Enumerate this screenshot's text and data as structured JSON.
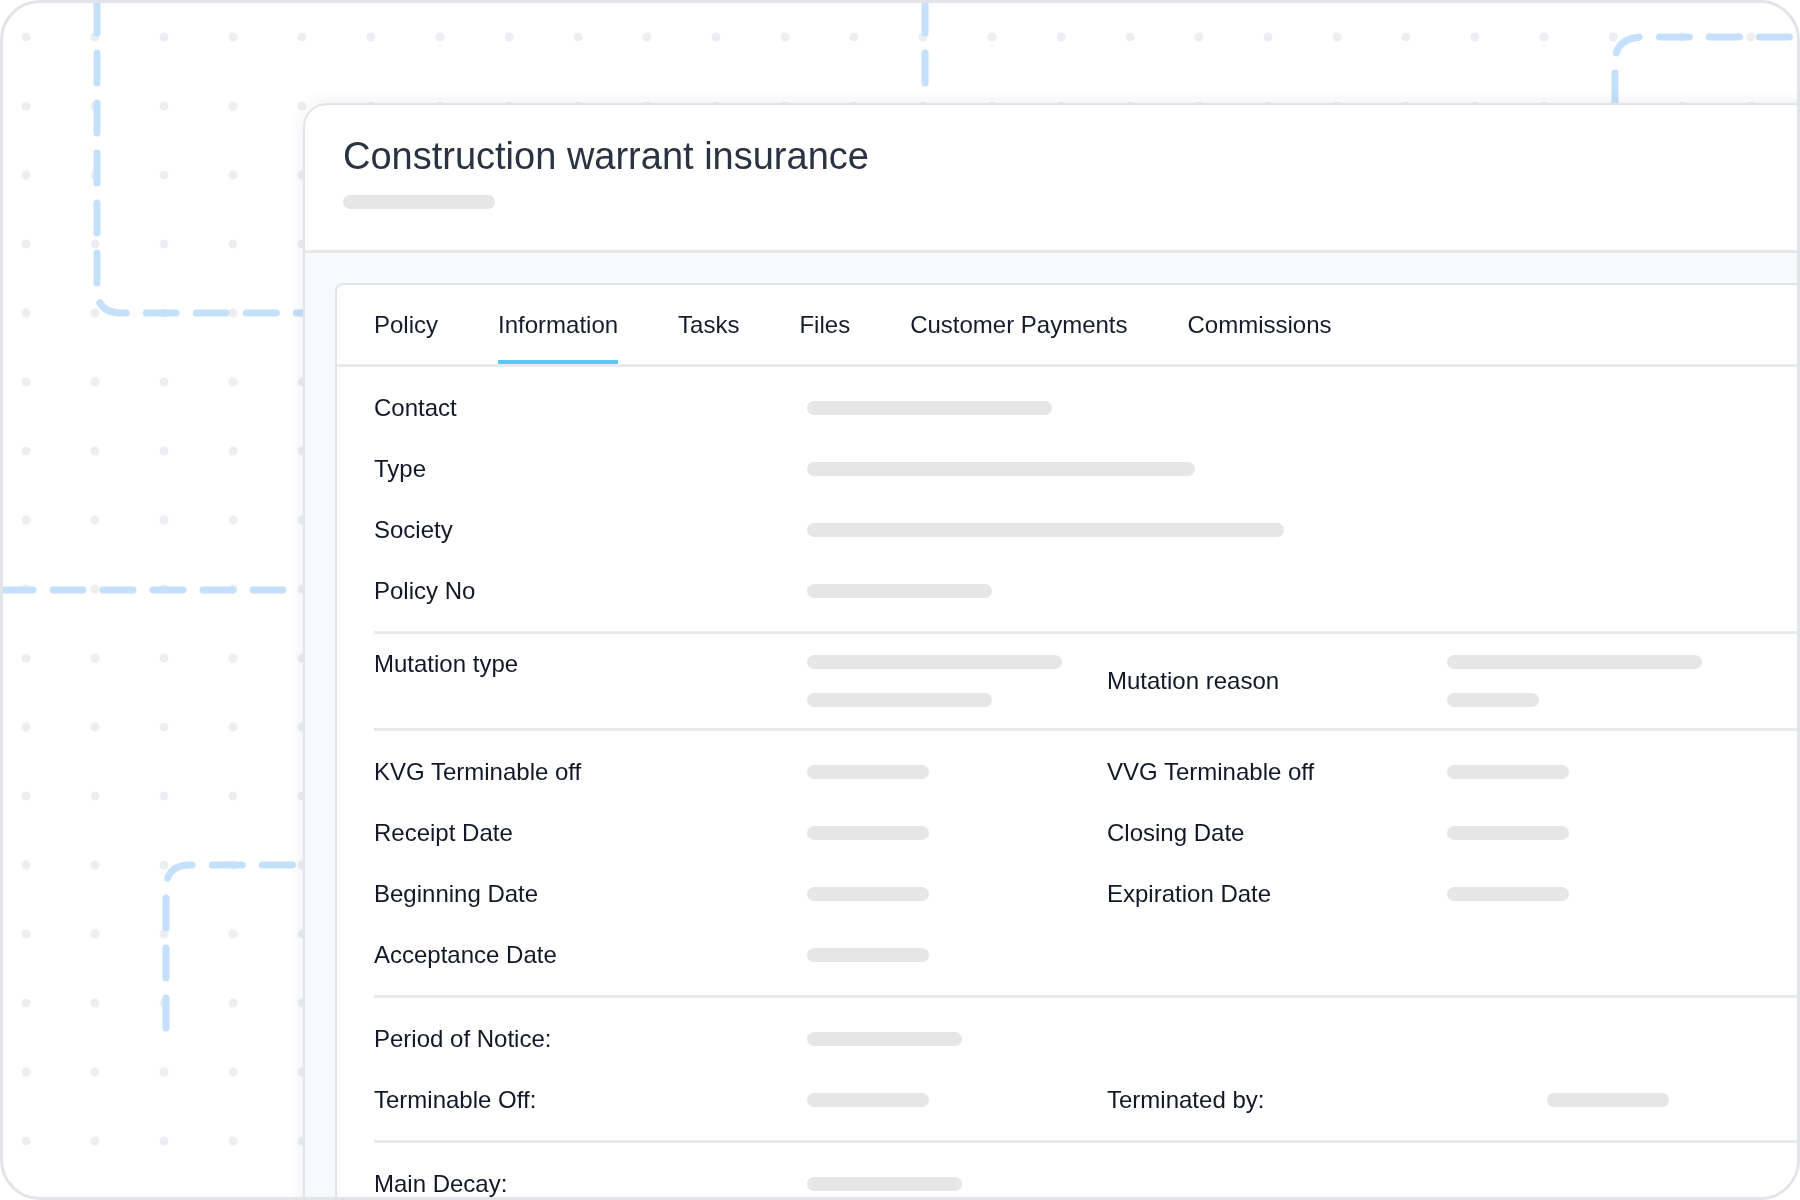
{
  "card": {
    "title": "Construction warrant insurance"
  },
  "tabs": [
    {
      "label": "Policy",
      "selected": false
    },
    {
      "label": "Information",
      "selected": true
    },
    {
      "label": "Tasks",
      "selected": false
    },
    {
      "label": "Files",
      "selected": false
    },
    {
      "label": "Customer Payments",
      "selected": false
    },
    {
      "label": "Commissions",
      "selected": false
    }
  ],
  "sections": [
    {
      "rows": [
        {
          "label": "Contact"
        },
        {
          "label": "Type"
        },
        {
          "label": "Society"
        },
        {
          "label": "Policy No"
        }
      ]
    },
    {
      "rows": [
        {
          "label": "Mutation type",
          "label_2": "Mutation reason"
        }
      ]
    },
    {
      "rows": [
        {
          "label": "KVG Terminable off",
          "label_2": "VVG Terminable off"
        },
        {
          "label": "Receipt Date",
          "label_2": "Closing Date"
        },
        {
          "label": "Beginning Date",
          "label_2": "Expiration Date"
        },
        {
          "label": "Acceptance Date"
        }
      ]
    },
    {
      "rows": [
        {
          "label": "Period of Notice:"
        },
        {
          "label": "Terminable Off:",
          "label_2": "Terminated by:"
        }
      ]
    },
    {
      "rows": [
        {
          "label": "Main Decay:"
        }
      ]
    }
  ]
}
